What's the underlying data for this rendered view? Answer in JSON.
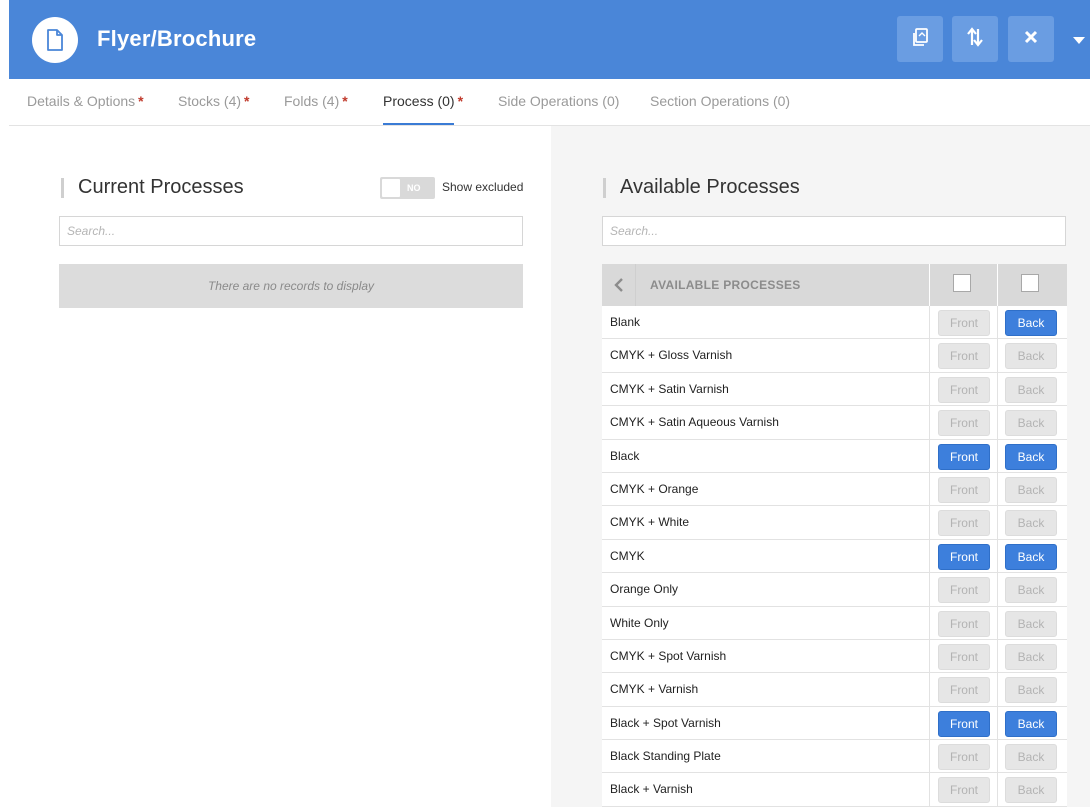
{
  "header": {
    "title": "Flyer/Brochure",
    "doc_icon": "document-icon",
    "buttons": [
      "copy-icon",
      "sort-icon",
      "close-icon"
    ],
    "dropdown_icon": "caret-down-icon",
    "color": "#4a86d8"
  },
  "tabs": [
    {
      "label": "Details & Options",
      "required": "*",
      "active": false
    },
    {
      "label": "Stocks (4)",
      "required": "*",
      "active": false
    },
    {
      "label": "Folds (4)",
      "required": "*",
      "active": false
    },
    {
      "label": "Process (0)",
      "required": "*",
      "active": true
    },
    {
      "label": "Side Operations (0)",
      "required": "",
      "active": false
    },
    {
      "label": "Section Operations (0)",
      "required": "",
      "active": false
    }
  ],
  "current": {
    "title": "Current Processes",
    "toggle_state": "NO",
    "toggle_label": "Show excluded",
    "search_placeholder": "Search...",
    "empty_text": "There are no records to display"
  },
  "available": {
    "title": "Available Processes",
    "search_placeholder": "Search...",
    "table_header": "AVAILABLE PROCESSES",
    "front_label": "Front",
    "back_label": "Back",
    "rows": [
      {
        "name": "Blank",
        "front": false,
        "back": true
      },
      {
        "name": "CMYK + Gloss Varnish",
        "front": false,
        "back": false
      },
      {
        "name": "CMYK + Satin Varnish",
        "front": false,
        "back": false
      },
      {
        "name": "CMYK + Satin Aqueous Varnish",
        "front": false,
        "back": false
      },
      {
        "name": "Black",
        "front": true,
        "back": true
      },
      {
        "name": "CMYK + Orange",
        "front": false,
        "back": false
      },
      {
        "name": "CMYK + White",
        "front": false,
        "back": false
      },
      {
        "name": "CMYK",
        "front": true,
        "back": true
      },
      {
        "name": "Orange Only",
        "front": false,
        "back": false
      },
      {
        "name": "White Only",
        "front": false,
        "back": false
      },
      {
        "name": "CMYK + Spot Varnish",
        "front": false,
        "back": false
      },
      {
        "name": "CMYK + Varnish",
        "front": false,
        "back": false
      },
      {
        "name": "Black + Spot Varnish",
        "front": true,
        "back": true
      },
      {
        "name": "Black Standing Plate",
        "front": false,
        "back": false
      },
      {
        "name": "Black + Varnish",
        "front": false,
        "back": false
      }
    ]
  },
  "colors": {
    "accent": "#3d7fdc",
    "required": "#c0392b",
    "disabled_button": "#e6e6e6"
  }
}
